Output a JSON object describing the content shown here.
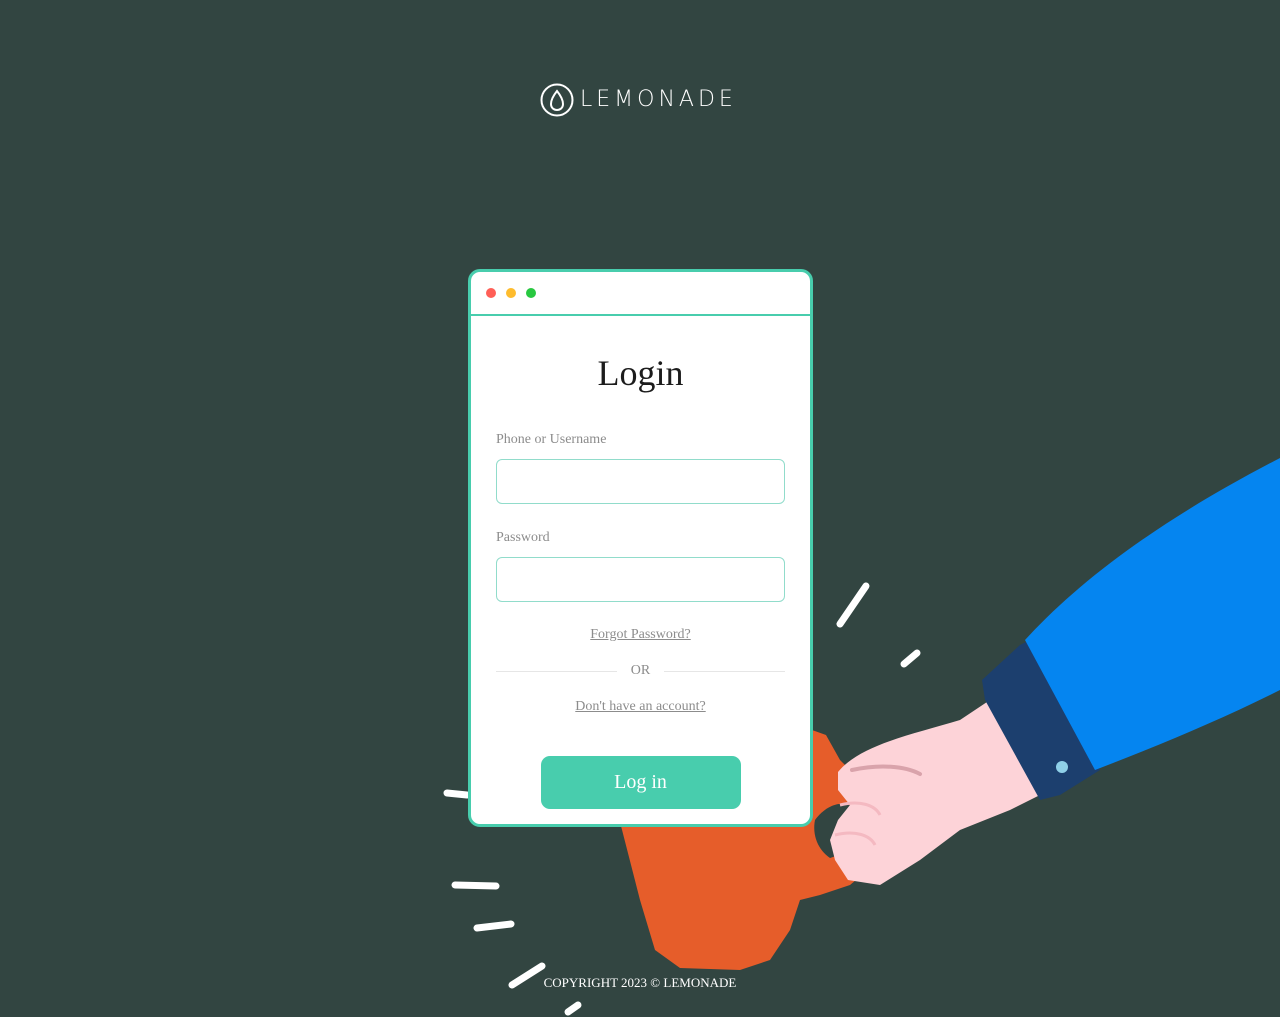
{
  "brand": {
    "logo_icon": "lemon-drop-icon",
    "name": "LEMONADE"
  },
  "window": {
    "controls": [
      {
        "name": "close-dot",
        "color": "#ff5f57"
      },
      {
        "name": "minimize-dot",
        "color": "#febc2e"
      },
      {
        "name": "maximize-dot",
        "color": "#28c840"
      }
    ]
  },
  "login": {
    "title": "Login",
    "username_label": "Phone or Username",
    "username_value": "",
    "password_label": "Password",
    "password_value": "",
    "forgot_link": "Forgot Password?",
    "divider_text": "OR",
    "signup_link": "Don't have an account?",
    "submit_label": "Log in"
  },
  "footer": {
    "copyright": "COPYRIGHT 2023 © LEMONADE"
  },
  "colors": {
    "background": "#324541",
    "accent": "#48cdad",
    "mug": "#e65d2a",
    "sleeve": "#0585f0",
    "cuff": "#1c3f6e",
    "hand": "#fdd3d8"
  }
}
